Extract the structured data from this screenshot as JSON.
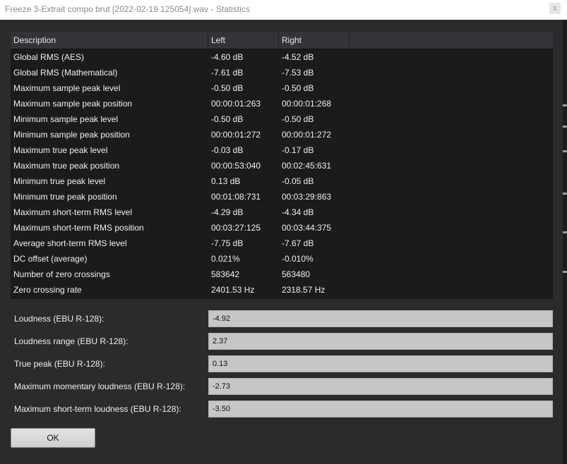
{
  "window": {
    "title": "Freeze 3-Extrait compo brut [2022-02-19 125054].wav - Statistics",
    "close_glyph": "x"
  },
  "table": {
    "columns": [
      "Description",
      "Left",
      "Right",
      ""
    ],
    "rows": [
      [
        "Global RMS (AES)",
        "-4.60 dB",
        "-4.52 dB"
      ],
      [
        "Global RMS (Mathematical)",
        "-7.61 dB",
        "-7.53 dB"
      ],
      [
        "Maximum sample peak level",
        "-0.50 dB",
        "-0.50 dB"
      ],
      [
        "Maximum sample peak position",
        "00:00:01:263",
        "00:00:01:268"
      ],
      [
        "Minimum sample peak level",
        "-0.50 dB",
        "-0.50 dB"
      ],
      [
        "Minimum sample peak position",
        "00:00:01:272",
        "00:00:01:272"
      ],
      [
        "Maximum true peak level",
        "-0.03 dB",
        "-0.17 dB"
      ],
      [
        "Maximum true peak position",
        "00:00:53:040",
        "00:02:45:631"
      ],
      [
        "Minimum true peak level",
        "0.13 dB",
        "-0.05 dB"
      ],
      [
        "Minimum true peak position",
        "00:01:08:731",
        "00:03:29:863"
      ],
      [
        "Maximum short-term RMS level",
        "-4.29 dB",
        "-4.34 dB"
      ],
      [
        "Maximum short-term RMS position",
        "00:03:27:125",
        "00:03:44:375"
      ],
      [
        "Average short-term RMS level",
        "-7.75 dB",
        "-7.67 dB"
      ],
      [
        "DC offset (average)",
        "0.021%",
        "-0.010%"
      ],
      [
        "Number of zero crossings",
        "583642",
        "563480"
      ],
      [
        "Zero crossing rate",
        "2401.53 Hz",
        "2318.57 Hz"
      ]
    ]
  },
  "loudness": [
    {
      "label": "Loudness (EBU R-128):",
      "value": "-4.92"
    },
    {
      "label": "Loudness range (EBU R-128):",
      "value": "2.37"
    },
    {
      "label": "True peak (EBU R-128):",
      "value": "0.13"
    },
    {
      "label": "Maximum momentary loudness (EBU R-128):",
      "value": "-2.73"
    },
    {
      "label": "Maximum short-term loudness (EBU R-128):",
      "value": "-3.50"
    }
  ],
  "ok_button": {
    "label": "OK"
  }
}
